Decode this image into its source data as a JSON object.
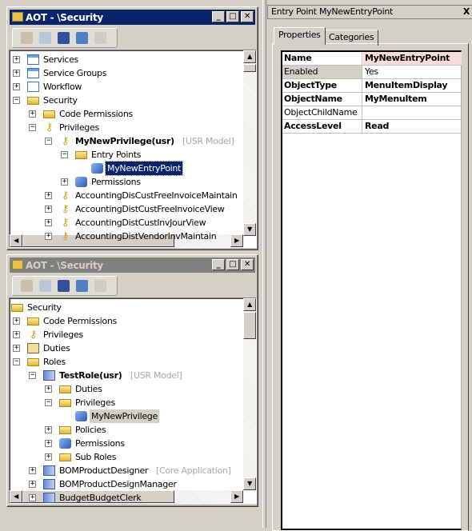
{
  "window1": {
    "title": "AOT - \\Security",
    "state": "active",
    "toolbar": [
      "open-icon",
      "properties-icon",
      "save-all-icon",
      "filter-icon",
      "import-icon"
    ],
    "tree": [
      {
        "level": 0,
        "exp": "+",
        "icon": "doc",
        "label": "Services"
      },
      {
        "level": 0,
        "exp": "+",
        "icon": "doc",
        "label": "Service Groups"
      },
      {
        "level": 0,
        "exp": "+",
        "icon": "wf",
        "label": "Workflow"
      },
      {
        "level": 0,
        "exp": "-",
        "icon": "folder",
        "label": "Security"
      },
      {
        "level": 1,
        "exp": "+",
        "icon": "folder",
        "label": "Code Permissions"
      },
      {
        "level": 1,
        "exp": "-",
        "icon": "key",
        "label": "Privileges"
      },
      {
        "level": 2,
        "exp": "-",
        "icon": "key",
        "label": "MyNewPrivilege(usr)",
        "bold": true,
        "tag": "[USR Model]"
      },
      {
        "level": 3,
        "exp": "-",
        "icon": "folder",
        "label": "Entry Points"
      },
      {
        "level": 4,
        "exp": "",
        "icon": "gear",
        "label": "MyNewEntryPoint",
        "selected": true
      },
      {
        "level": 3,
        "exp": "+",
        "icon": "gear",
        "label": "Permissions"
      },
      {
        "level": 2,
        "exp": "+",
        "icon": "key",
        "label": "AccountingDisCustFreeInvoiceMaintain"
      },
      {
        "level": 2,
        "exp": "+",
        "icon": "key",
        "label": "AccountingDistCustFreeInvoiceView"
      },
      {
        "level": 2,
        "exp": "+",
        "icon": "key",
        "label": "AccountingDistCustInvJourView"
      },
      {
        "level": 2,
        "exp": "+",
        "icon": "key",
        "label": "AccountingDistVendorInvMaintain"
      }
    ]
  },
  "window2": {
    "title": "AOT - \\Security",
    "state": "inactive",
    "toolbar": [
      "open-icon",
      "properties-icon",
      "save-all-icon",
      "filter-icon",
      "import-icon"
    ],
    "tree": [
      {
        "level": 0,
        "exp": "",
        "icon": "folder",
        "label": "Security"
      },
      {
        "level": 1,
        "exp": "+",
        "icon": "folder",
        "label": "Code Permissions"
      },
      {
        "level": 1,
        "exp": "+",
        "icon": "key",
        "label": "Privileges"
      },
      {
        "level": 1,
        "exp": "+",
        "icon": "duty",
        "label": "Duties"
      },
      {
        "level": 1,
        "exp": "-",
        "icon": "folder",
        "label": "Roles"
      },
      {
        "level": 2,
        "exp": "-",
        "icon": "role",
        "label": "TestRole(usr)",
        "bold": true,
        "tag": "[USR Model]"
      },
      {
        "level": 3,
        "exp": "+",
        "icon": "folder",
        "label": "Duties"
      },
      {
        "level": 3,
        "exp": "-",
        "icon": "folder",
        "label": "Privileges"
      },
      {
        "level": 4,
        "exp": "",
        "icon": "gear",
        "label": "MyNewPrivilege",
        "highlighted": true
      },
      {
        "level": 3,
        "exp": "+",
        "icon": "folder",
        "label": "Policies"
      },
      {
        "level": 3,
        "exp": "+",
        "icon": "gear",
        "label": "Permissions"
      },
      {
        "level": 3,
        "exp": "+",
        "icon": "folder",
        "label": "Sub Roles"
      },
      {
        "level": 2,
        "exp": "+",
        "icon": "role",
        "label": "BOMProductDesigner",
        "tag": "[Core Application]"
      },
      {
        "level": 2,
        "exp": "+",
        "icon": "role",
        "label": "BOMProductDesignManager"
      },
      {
        "level": 2,
        "exp": "+",
        "icon": "role",
        "label": "BudgetBudgetClerk"
      }
    ]
  },
  "properties": {
    "title": "Entry Point MyNewEntryPoint",
    "close": "X",
    "tabs": [
      {
        "label": "Properties",
        "active": true
      },
      {
        "label": "Categories",
        "active": false
      }
    ],
    "rows": [
      {
        "name": "Name",
        "value": "MyNewEntryPoint",
        "bold": true,
        "highlight": "#fbdada"
      },
      {
        "name": "Enabled",
        "value": "Yes",
        "bold": false,
        "nameBg": "#d4d0c8"
      },
      {
        "name": "ObjectType",
        "value": "MenuItemDisplay",
        "bold": true
      },
      {
        "name": "ObjectName",
        "value": "MyMenuItem",
        "bold": true
      },
      {
        "name": "ObjectChildName",
        "value": "",
        "bold": false
      },
      {
        "name": "AccessLevel",
        "value": "Read",
        "bold": true
      }
    ]
  }
}
